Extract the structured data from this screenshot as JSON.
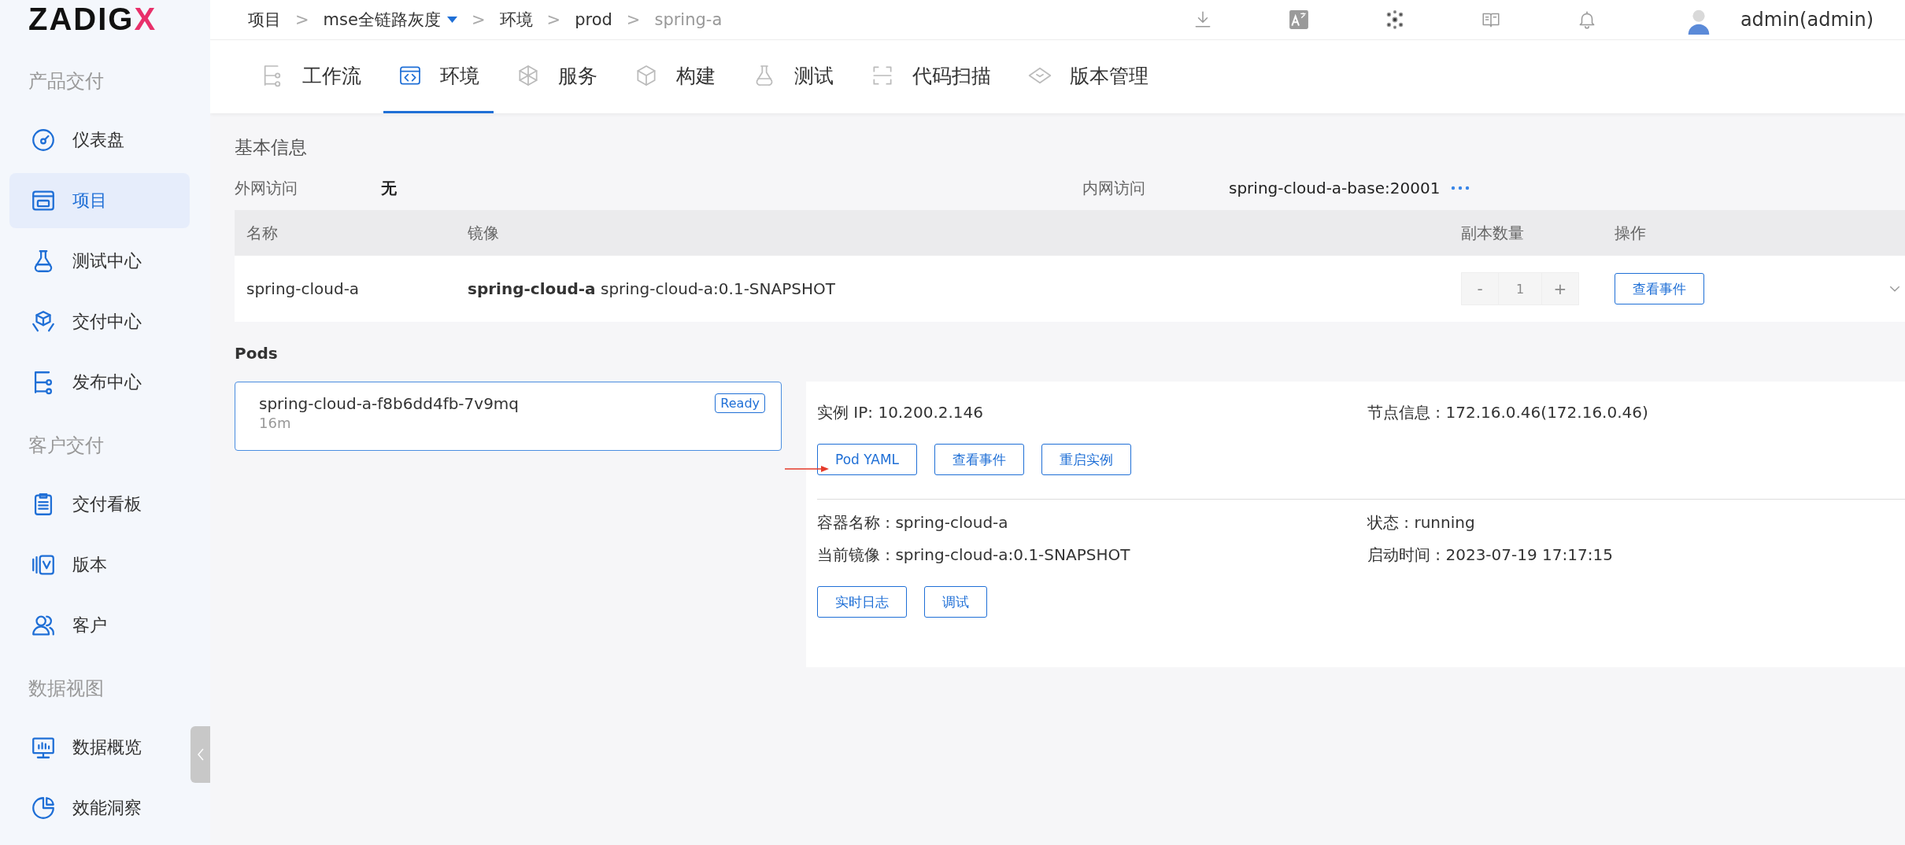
{
  "logo": {
    "text": "ZADIG",
    "accent": "X"
  },
  "breadcrumb": [
    {
      "kind": "link",
      "text": "项目"
    },
    {
      "kind": "separator",
      "text": ">"
    },
    {
      "kind": "dropdown",
      "text": "mse全链路灰度"
    },
    {
      "kind": "separator",
      "text": ">"
    },
    {
      "kind": "link",
      "text": "环境"
    },
    {
      "kind": "separator",
      "text": ">"
    },
    {
      "kind": "link",
      "text": "prod"
    },
    {
      "kind": "separator",
      "text": ">"
    },
    {
      "kind": "current",
      "text": "spring-a"
    }
  ],
  "user": {
    "name": "admin(admin)"
  },
  "sidebar": {
    "sections": [
      {
        "title": "产品交付",
        "items": [
          {
            "label": "仪表盘",
            "selected": false
          },
          {
            "label": "项目",
            "selected": true
          },
          {
            "label": "测试中心",
            "selected": false
          },
          {
            "label": "交付中心",
            "selected": false
          },
          {
            "label": "发布中心",
            "selected": false
          }
        ]
      },
      {
        "title": "客户交付",
        "items": [
          {
            "label": "交付看板",
            "selected": false
          },
          {
            "label": "版本",
            "selected": false
          },
          {
            "label": "客户",
            "selected": false
          }
        ]
      },
      {
        "title": "数据视图",
        "items": [
          {
            "label": "数据概览",
            "selected": false
          },
          {
            "label": "效能洞察",
            "selected": false
          }
        ]
      }
    ]
  },
  "tabs": [
    {
      "label": "工作流",
      "selected": false
    },
    {
      "label": "环境",
      "selected": true
    },
    {
      "label": "服务",
      "selected": false
    },
    {
      "label": "构建",
      "selected": false
    },
    {
      "label": "测试",
      "selected": false
    },
    {
      "label": "代码扫描",
      "selected": false
    },
    {
      "label": "版本管理",
      "selected": false
    }
  ],
  "basic_info": {
    "title": "基本信息",
    "external_label": "外网访问",
    "external_value": "无",
    "internal_label": "内网访问",
    "internal_value": "spring-cloud-a-base:20001"
  },
  "table": {
    "columns": [
      "名称",
      "镜像",
      "副本数量",
      "操作"
    ],
    "rows": [
      {
        "name": "spring-cloud-a",
        "image_name": "spring-cloud-a",
        "image": "spring-cloud-a:0.1-SNAPSHOT",
        "replicas": {
          "decrement": "-",
          "value": "1",
          "increment": "+",
          "disabled": true
        },
        "action": "查看事件",
        "expanded": false
      }
    ]
  },
  "pods": {
    "title": "Pods",
    "items": [
      {
        "name": "spring-cloud-a-f8b6dd4fb-7v9mq",
        "status": "Ready",
        "age": "16m",
        "selected": true
      }
    ],
    "detail": {
      "instance_ip": "实例 IP: 10.200.2.146",
      "node_info": "节点信息 : 172.16.0.46(172.16.0.46)",
      "buttons": [
        "Pod YAML",
        "查看事件",
        "重启实例"
      ],
      "container": {
        "name": "容器名称 : spring-cloud-a",
        "state": "状态 : running",
        "image": "当前镜像 : spring-cloud-a:0.1-SNAPSHOT",
        "started": "启动时间 : 2023-07-19 17:17:15",
        "buttons": [
          "实时日志",
          "调试"
        ]
      }
    }
  }
}
